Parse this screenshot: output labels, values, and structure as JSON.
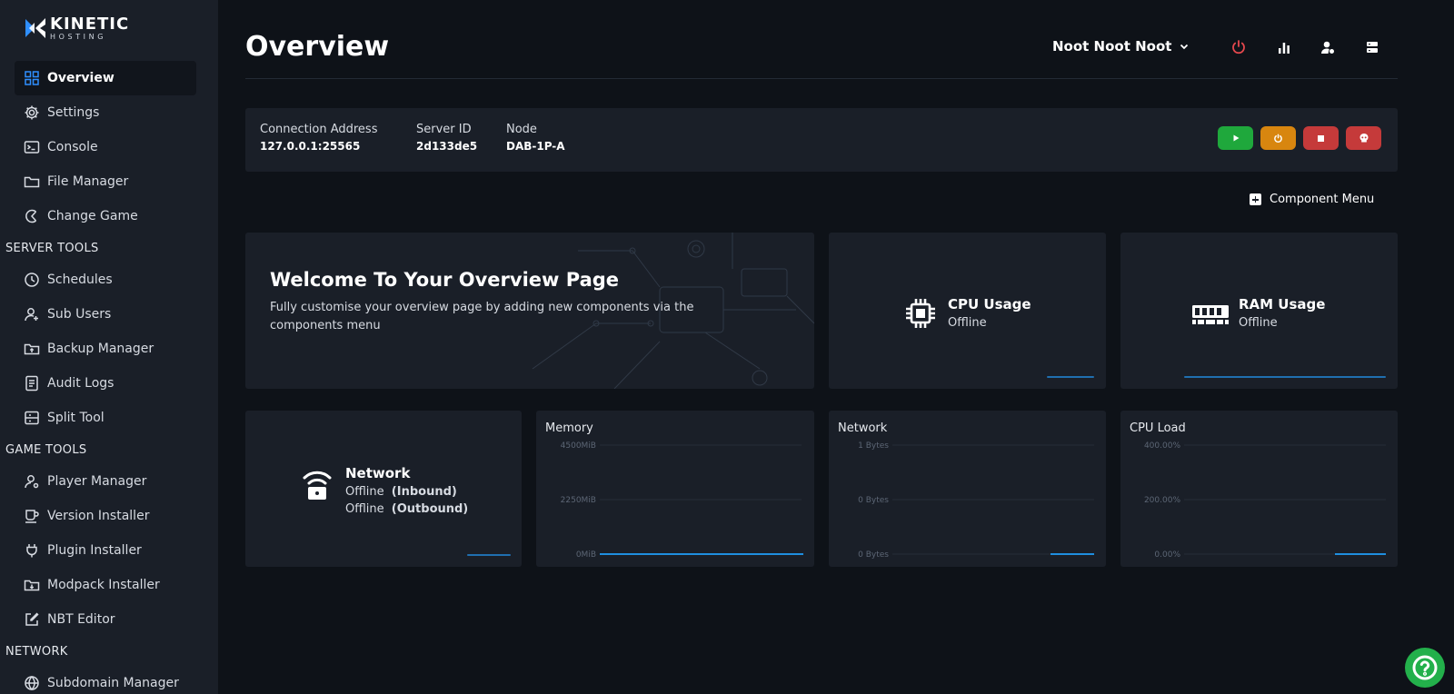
{
  "logo": {
    "name": "KINETIC",
    "sub": "HOSTING"
  },
  "sidebar": {
    "items": [
      {
        "label": "Overview",
        "icon": "grid-icon",
        "active": true
      },
      {
        "label": "Settings",
        "icon": "gear-icon"
      },
      {
        "label": "Console",
        "icon": "terminal-icon"
      },
      {
        "label": "File Manager",
        "icon": "folder-icon"
      },
      {
        "label": "Change Game",
        "icon": "game-icon"
      }
    ],
    "server_tools_title": "SERVER TOOLS",
    "server_tools": [
      {
        "label": "Schedules",
        "icon": "clock-icon"
      },
      {
        "label": "Sub Users",
        "icon": "user-plus-icon"
      },
      {
        "label": "Backup Manager",
        "icon": "backup-icon"
      },
      {
        "label": "Audit Logs",
        "icon": "document-icon"
      },
      {
        "label": "Split Tool",
        "icon": "split-icon"
      }
    ],
    "game_tools_title": "GAME TOOLS",
    "game_tools": [
      {
        "label": "Player Manager",
        "icon": "user-gear-icon"
      },
      {
        "label": "Version Installer",
        "icon": "coffee-icon"
      },
      {
        "label": "Plugin Installer",
        "icon": "plug-icon"
      },
      {
        "label": "Modpack Installer",
        "icon": "download-box-icon"
      },
      {
        "label": "NBT Editor",
        "icon": "edit-icon"
      }
    ],
    "network_title": "NETWORK",
    "network": [
      {
        "label": "Subdomain Manager",
        "icon": "globe-icon"
      }
    ]
  },
  "header": {
    "title": "Overview",
    "server_name": "Noot Noot Noot",
    "icons": [
      "power-icon",
      "bar-chart-icon",
      "user-settings-icon",
      "server-icon"
    ],
    "power_color": "#e5484d"
  },
  "info": {
    "connection_label": "Connection Address",
    "connection_value": "127.0.0.1:25565",
    "server_id_label": "Server ID",
    "server_id_value": "2d133de5",
    "node_label": "Node",
    "node_value": "DAB-1P-A",
    "buttons": [
      {
        "name": "start-button",
        "icon": "play-icon",
        "color": "#1fa83c"
      },
      {
        "name": "restart-button",
        "icon": "restart-icon",
        "color": "#d8860f"
      },
      {
        "name": "stop-button",
        "icon": "stop-icon",
        "color": "#c53a3a"
      },
      {
        "name": "kill-button",
        "icon": "skull-icon",
        "color": "#c53a3a"
      }
    ]
  },
  "component_menu": "Component Menu",
  "welcome": {
    "title": "Welcome To Your Overview Page",
    "description": "Fully customise your overview page by adding new components via the components menu"
  },
  "cpu": {
    "title": "CPU Usage",
    "status": "Offline"
  },
  "ram": {
    "title": "RAM Usage",
    "status": "Offline"
  },
  "network_card": {
    "title": "Network",
    "inbound_status": "Offline",
    "inbound_label": "(Inbound)",
    "outbound_status": "Offline",
    "outbound_label": "(Outbound)"
  },
  "chart_data": [
    {
      "type": "line",
      "title": "Memory",
      "yticks": [
        "4500MiB",
        "2250MiB",
        "0MiB"
      ],
      "ylim": [
        0,
        4500
      ],
      "series": [
        {
          "values": [
            0,
            0,
            0,
            0,
            0,
            0,
            0,
            0,
            0,
            0
          ]
        }
      ],
      "color": "#1f8fe0"
    },
    {
      "type": "line",
      "title": "Network",
      "yticks": [
        "1 Bytes",
        "0 Bytes",
        "0 Bytes"
      ],
      "ylim": [
        0,
        1
      ],
      "series": [
        {
          "values": [
            0,
            0,
            0,
            0
          ]
        }
      ],
      "color": "#1f8fe0"
    },
    {
      "type": "line",
      "title": "CPU Load",
      "yticks": [
        "400.00%",
        "200.00%",
        "0.00%"
      ],
      "ylim": [
        0,
        400
      ],
      "series": [
        {
          "values": [
            0,
            0,
            0,
            0
          ]
        }
      ],
      "color": "#1f8fe0"
    }
  ],
  "accent_color": "#2f8fff",
  "help_icon": "question-icon"
}
